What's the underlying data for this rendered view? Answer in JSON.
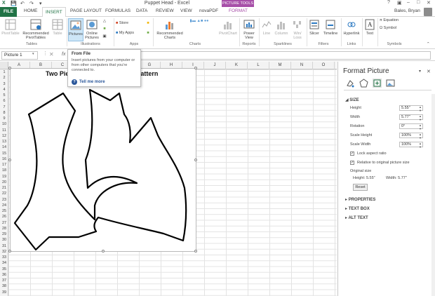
{
  "window": {
    "title": "Puppet Head - Excel",
    "context_title": "PICTURE TOOLS",
    "user": "Bales, Bryan"
  },
  "tabs": [
    "FILE",
    "HOME",
    "INSERT",
    "PAGE LAYOUT",
    "FORMULAS",
    "DATA",
    "REVIEW",
    "VIEW",
    "novaPDF",
    "FORMAT"
  ],
  "ribbon": {
    "tables": {
      "pivottable": "PivotTable",
      "recommended_pivot": "Recommended PivotTables",
      "table": "Table",
      "label": "Tables"
    },
    "illustrations": {
      "pictures": "Pictures",
      "online_pictures": "Online Pictures",
      "label": "Illustrations"
    },
    "apps": {
      "store": "Store",
      "my_apps": "My Apps",
      "label": "Apps"
    },
    "charts": {
      "recommended": "Recommended Charts",
      "pivotchart": "PivotChart",
      "label": "Charts"
    },
    "reports": {
      "power_view": "Power View",
      "label": "Reports"
    },
    "sparklines": {
      "line": "Line",
      "column": "Column",
      "win_loss": "Win/ Loss",
      "label": "Sparklines"
    },
    "filters": {
      "slicer": "Slicer",
      "timeline": "Timeline",
      "label": "Filters"
    },
    "links": {
      "hyperlink": "Hyperlink",
      "label": "Links"
    },
    "text": {
      "text": "Text",
      "label": ""
    },
    "symbols": {
      "equation": "Equation",
      "symbol": "Symbol",
      "label": "Symbols"
    }
  },
  "formula_bar": {
    "name_box": "Picture 1",
    "fx": "fx",
    "value": ""
  },
  "grid": {
    "columns": [
      "A",
      "B",
      "C",
      "D",
      "E",
      "F",
      "G",
      "H",
      "I",
      "J",
      "K",
      "L",
      "M",
      "N",
      "O"
    ],
    "rows": [
      "1",
      "2",
      "3",
      "4",
      "5",
      "6",
      "7",
      "8",
      "9",
      "10",
      "11",
      "12",
      "13",
      "14",
      "15",
      "16",
      "17",
      "18",
      "19",
      "20",
      "21",
      "22",
      "23",
      "24",
      "25",
      "26",
      "27",
      "28",
      "29",
      "30",
      "31",
      "32",
      "33",
      "34",
      "35",
      "36",
      "37",
      "38",
      "39"
    ]
  },
  "picture": {
    "title": "Two Pie",
    "title_tail": "attern"
  },
  "tooltip": {
    "title": "From File",
    "description": "Insert pictures from your computer or from other computers that you're connected to.",
    "more": "Tell me more"
  },
  "format_panel": {
    "title": "Format Picture",
    "size_section": "SIZE",
    "height_label": "Height",
    "height_value": "5.55\"",
    "width_label": "Width",
    "width_value": "5.77\"",
    "rotation_label": "Rotation",
    "rotation_value": "0°",
    "scale_height_label": "Scale Height",
    "scale_height_value": "100%",
    "scale_width_label": "Scale Width",
    "scale_width_value": "100%",
    "lock_aspect_label": "Lock aspect ratio",
    "lock_aspect_checked": true,
    "relative_label": "Relative to original picture size",
    "relative_checked": true,
    "original_size_label": "Original size",
    "original_height": "Height:  5.55\"",
    "original_width": "Width:  5.77\"",
    "reset_label": "Reset",
    "properties_section": "PROPERTIES",
    "text_box_section": "TEXT BOX",
    "alt_text_section": "ALT TEXT"
  },
  "colors": {
    "excel_green": "#217346",
    "picture_tools": "#a74fa8",
    "link_blue": "#2b579a"
  }
}
